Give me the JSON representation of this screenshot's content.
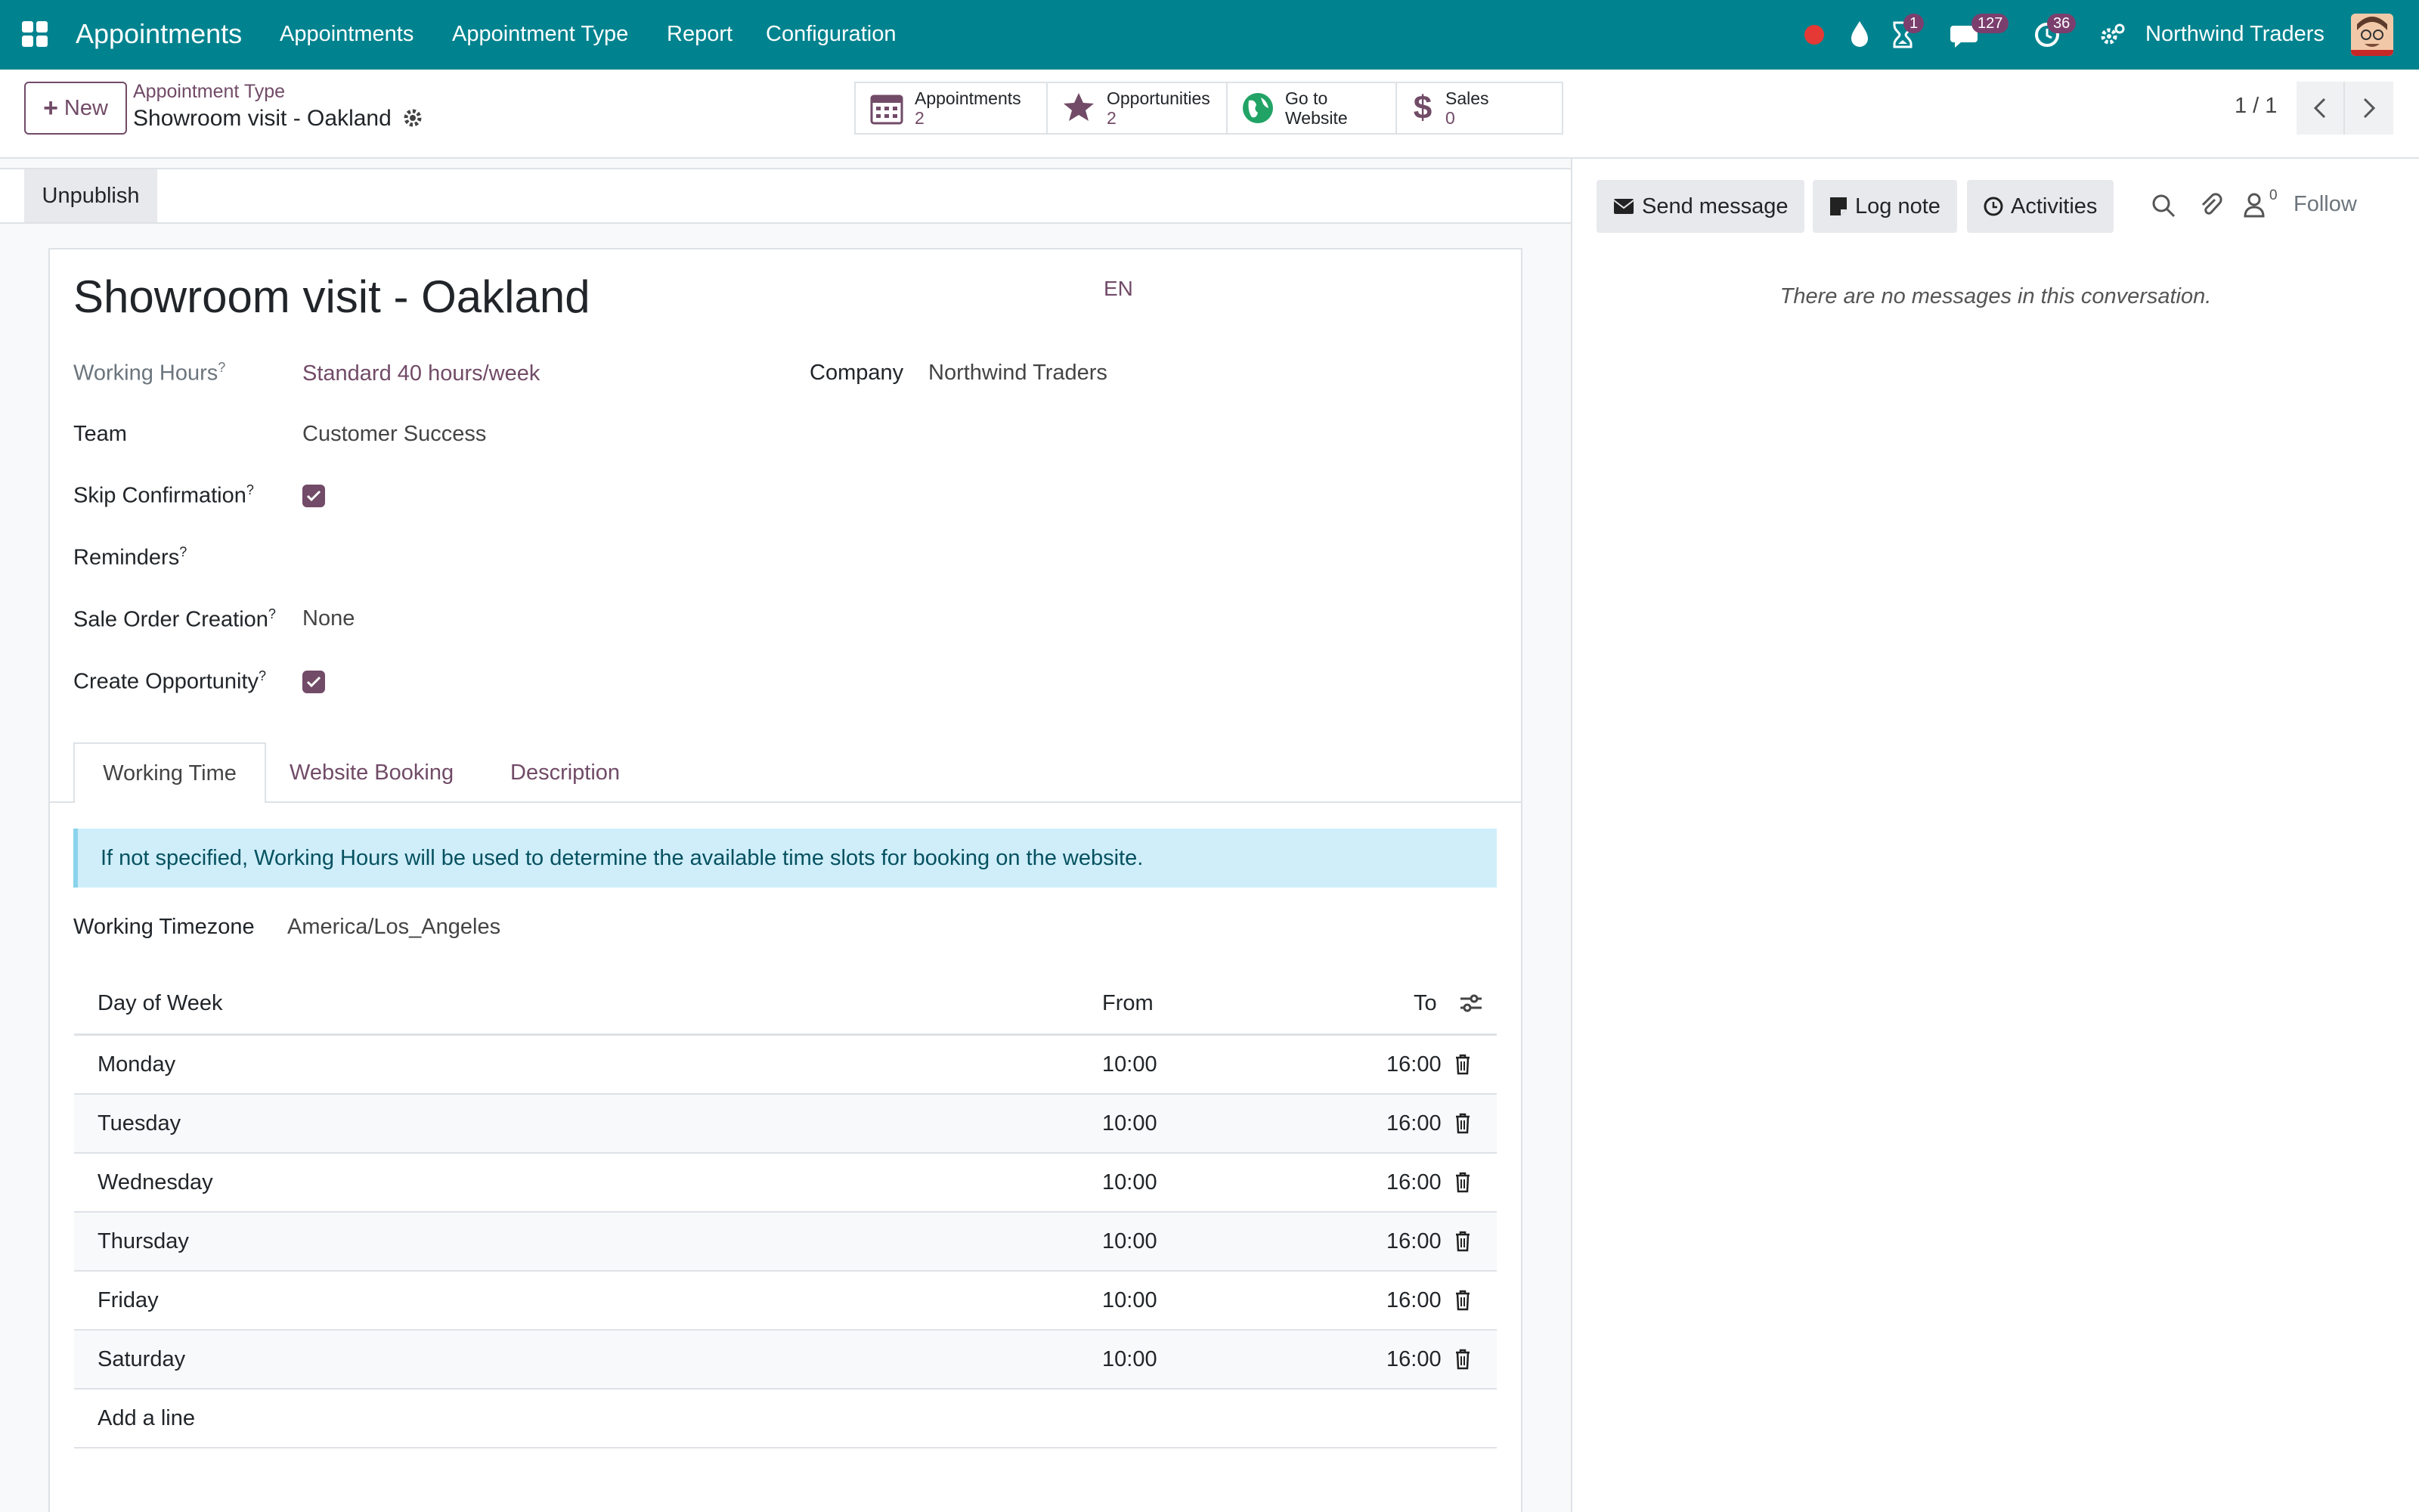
{
  "topbar": {
    "app_name": "Appointments",
    "menu": [
      "Appointments",
      "Appointment Type",
      "Report",
      "Configuration"
    ],
    "badges": {
      "activities": "1",
      "messages": "127",
      "timer": "36"
    },
    "company": "Northwind Traders",
    "icons": [
      "apps-grid-icon",
      "record-dot-icon",
      "drop-icon",
      "hourglass-icon",
      "chat-icon",
      "clock-icon",
      "settings-icon",
      "avatar"
    ]
  },
  "control": {
    "new_label": "New",
    "breadcrumb_parent": "Appointment Type",
    "breadcrumb_current": "Showroom visit - Oakland",
    "stats": [
      {
        "label": "Appointments",
        "value": "2"
      },
      {
        "label": "Opportunities",
        "value": "2"
      },
      {
        "label": "Go to",
        "label2": "Website"
      },
      {
        "label": "Sales",
        "value": "0"
      }
    ],
    "pager": "1 / 1"
  },
  "statusbar": {
    "unpublish_label": "Unpublish"
  },
  "form": {
    "title": "Showroom visit - Oakland",
    "lang": "EN",
    "fields": {
      "working_hours_label": "Working Hours",
      "working_hours_value": "Standard 40 hours/week",
      "company_label": "Company",
      "company_value": "Northwind Traders",
      "team_label": "Team",
      "team_value": "Customer Success",
      "skip_confirmation_label": "Skip Confirmation",
      "skip_confirmation": true,
      "reminders_label": "Reminders",
      "sale_order_label": "Sale Order Creation",
      "sale_order_value": "None",
      "create_opportunity_label": "Create Opportunity",
      "create_opportunity": true
    },
    "help_mark": "?",
    "tabs": [
      "Working Time",
      "Website Booking",
      "Description"
    ],
    "active_tab": "Working Time",
    "info_text": "If not specified, Working Hours will be used to determine the available time slots for booking on the website.",
    "timezone_label": "Working Timezone",
    "timezone_value": "America/Los_Angeles",
    "table": {
      "headers": [
        "Day of Week",
        "From",
        "To"
      ],
      "rows": [
        {
          "day": "Monday",
          "from": "10:00",
          "to": "16:00"
        },
        {
          "day": "Tuesday",
          "from": "10:00",
          "to": "16:00"
        },
        {
          "day": "Wednesday",
          "from": "10:00",
          "to": "16:00"
        },
        {
          "day": "Thursday",
          "from": "10:00",
          "to": "16:00"
        },
        {
          "day": "Friday",
          "from": "10:00",
          "to": "16:00"
        },
        {
          "day": "Saturday",
          "from": "10:00",
          "to": "16:00"
        }
      ],
      "add_line": "Add a line"
    }
  },
  "chatter": {
    "send_message": "Send message",
    "log_note": "Log note",
    "activities": "Activities",
    "followers_count": "0",
    "follow": "Follow",
    "empty_text": "There are no messages in this conversation."
  },
  "colors": {
    "topbar": "#00838f",
    "accent": "#714b67",
    "info_bg": "#cfeefa",
    "info_text": "#055160"
  }
}
